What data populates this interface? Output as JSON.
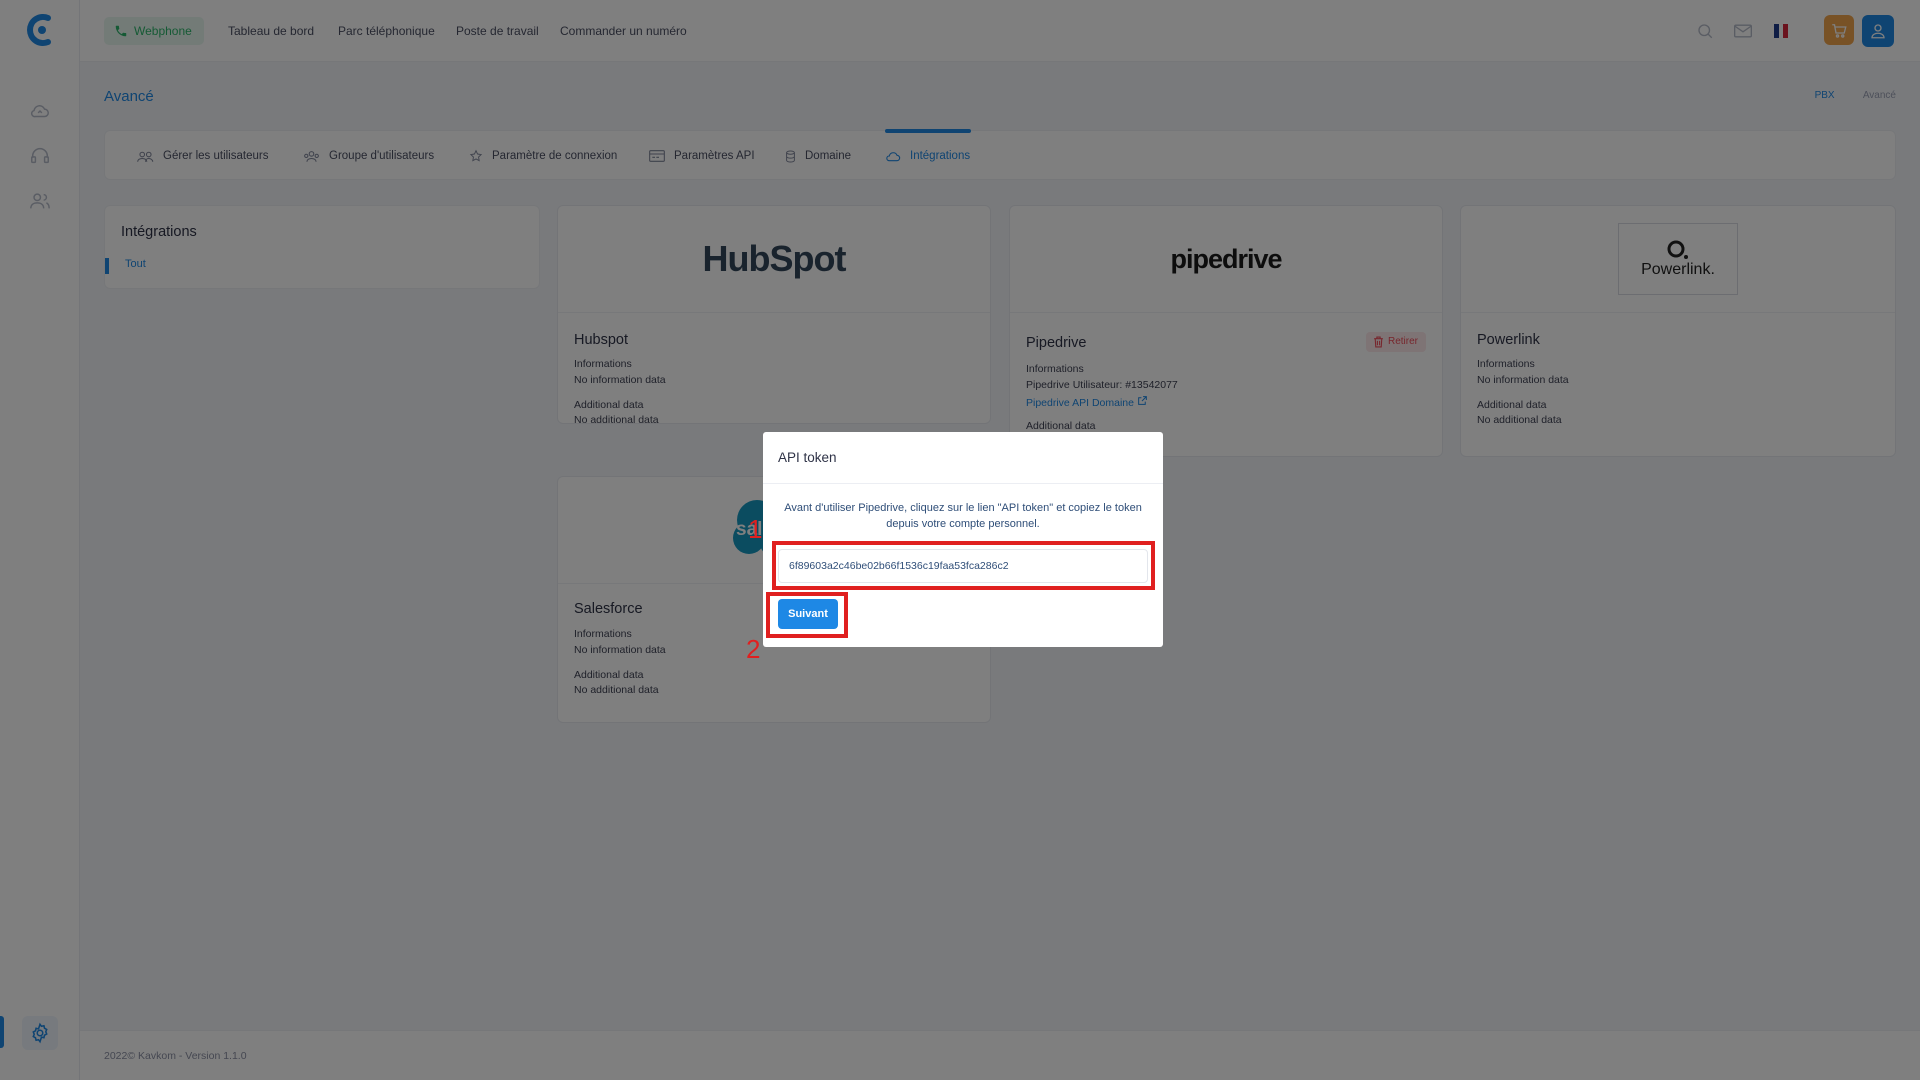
{
  "topbar": {
    "webphone_label": "Webphone",
    "nav": [
      "Tableau de bord",
      "Parc téléphonique",
      "Poste de travail",
      "Commander un numéro"
    ]
  },
  "page": {
    "title": "Avancé",
    "breadcrumb": [
      "PBX",
      "Avancé"
    ]
  },
  "tabs": [
    {
      "label": "Gérer les utilisateurs",
      "icon": "users-icon"
    },
    {
      "label": "Groupe d'utilisateurs",
      "icon": "group-icon"
    },
    {
      "label": "Paramètre de connexion",
      "icon": "star-icon"
    },
    {
      "label": "Paramètres API",
      "icon": "api-icon"
    },
    {
      "label": "Domaine",
      "icon": "database-icon"
    },
    {
      "label": "Intégrations",
      "icon": "cloud-icon",
      "active": true
    }
  ],
  "filter": {
    "title": "Intégrations",
    "items": [
      "Tout"
    ]
  },
  "cards": {
    "hubspot": {
      "logo_text": "HubSpot",
      "name": "Hubspot",
      "info_label": "Informations",
      "info_value": "No information data",
      "additional_label": "Additional data",
      "additional_value": "No additional data"
    },
    "pipedrive": {
      "logo_text": "pipedrive",
      "name": "Pipedrive",
      "remove_label": "Retirer",
      "info_label": "Informations",
      "user_line": "Pipedrive Utilisateur: #13542077",
      "link_label": "Pipedrive API Domaine",
      "additional_label": "Additional data"
    },
    "powerlink": {
      "logo_text": "Powerlink.",
      "name": "Powerlink",
      "info_label": "Informations",
      "info_value": "No information data",
      "additional_label": "Additional data",
      "additional_value": "No additional data"
    },
    "salesforce": {
      "logo_text": "sal",
      "name": "Salesforce",
      "info_label": "Informations",
      "info_value": "No information data",
      "additional_label": "Additional data",
      "additional_value": "No additional data"
    }
  },
  "modal": {
    "title": "API token",
    "description": "Avant d'utiliser Pipedrive, cliquez sur le lien \"API token\" et copiez le token depuis votre compte personnel.",
    "token_value": "6f89603a2c46be02b66f1536c19faa53fca286c2",
    "next_label": "Suivant"
  },
  "annotations": [
    "1",
    "2"
  ],
  "footer": {
    "text": "2022© Kavkom - Version 1.1.0"
  },
  "colors": {
    "accent": "#1e88e5",
    "webphone_green": "#2cb56b",
    "cart_orange": "#f0a44c",
    "highlight_red": "#e02020"
  }
}
